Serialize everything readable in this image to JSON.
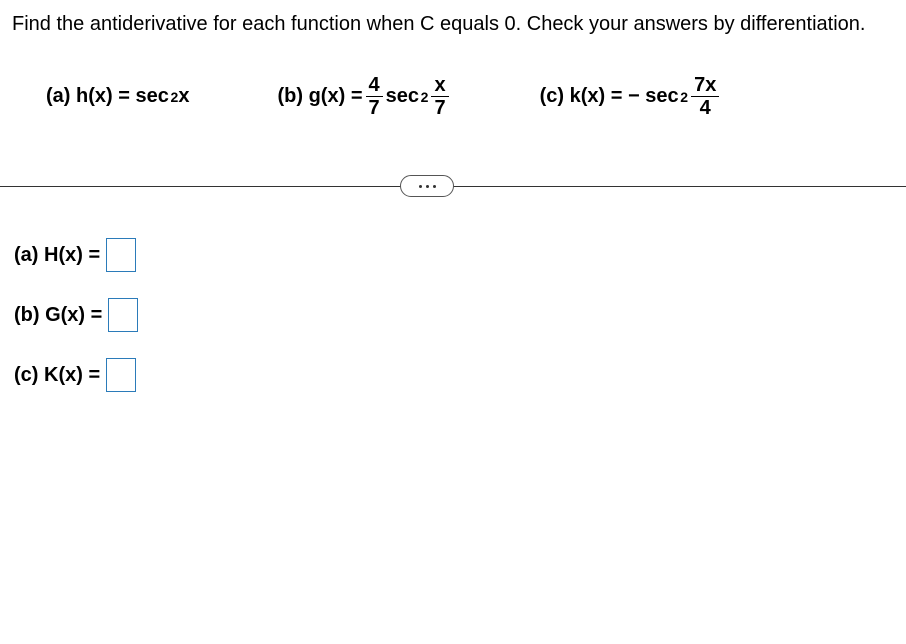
{
  "instructions": "Find the antiderivative for each function when C equals 0. Check your answers by differentiation.",
  "problems": {
    "a": {
      "label": "(a)",
      "func_name": "h(x)",
      "equals": "=",
      "sec": "sec",
      "exp": "2",
      "arg": "x"
    },
    "b": {
      "label": "(b)",
      "func_name": "g(x)",
      "equals": "=",
      "coef_num": "4",
      "coef_den": "7",
      "sec": "sec",
      "exp": "2",
      "arg_num": "x",
      "arg_den": "7"
    },
    "c": {
      "label": "(c)",
      "func_name": "k(x)",
      "equals": "= −",
      "sec": "sec",
      "exp": "2",
      "arg_num": "7x",
      "arg_den": "4"
    }
  },
  "answers": {
    "a": {
      "label": "(a) H(x) ="
    },
    "b": {
      "label": "(b) G(x) ="
    },
    "c": {
      "label": "(c) K(x) ="
    }
  }
}
